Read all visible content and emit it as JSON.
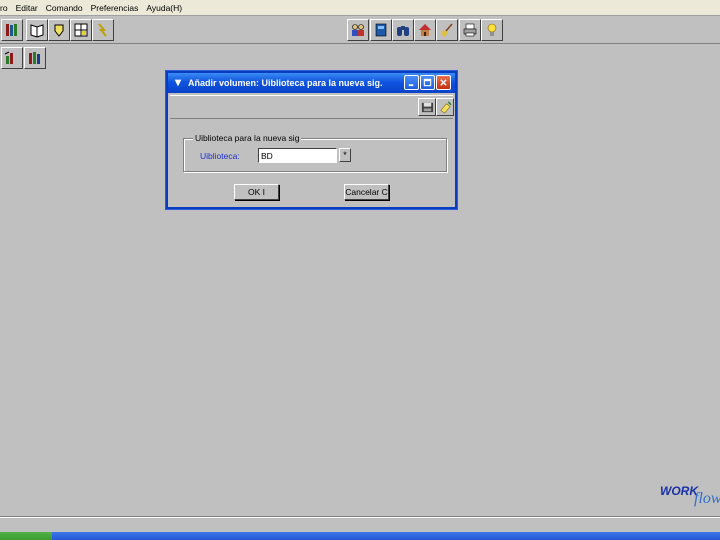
{
  "menu": {
    "items": [
      {
        "label": "ro"
      },
      {
        "label": "Editar"
      },
      {
        "label": "Comando"
      },
      {
        "label": "Preferencias"
      },
      {
        "label": "Ayuda(H)"
      }
    ]
  },
  "toolbar": {
    "icons": [
      "library-books-icon",
      "open-book-icon",
      "shield-icon",
      "window-grid-icon",
      "wand-icon",
      "people-icon",
      "blue-book-icon",
      "binoculars-icon",
      "house-icon",
      "broom-icon",
      "printer-icon",
      "lightbulb-icon"
    ]
  },
  "toolbar2": {
    "icons": [
      "chart-books-icon"
    ]
  },
  "dialog": {
    "title": "Añadir volumen: Uiblioteca para la nueva sig.",
    "group_legend": "Uiblioteca para la nueva sig",
    "field_label": "Uiblioteca:",
    "field_value": "BD",
    "lookup_label": "*",
    "ok_label": "OK  I",
    "cancel_label": "Cancelar  C"
  },
  "logo": {
    "part1": "WORK",
    "part2": "flow"
  }
}
